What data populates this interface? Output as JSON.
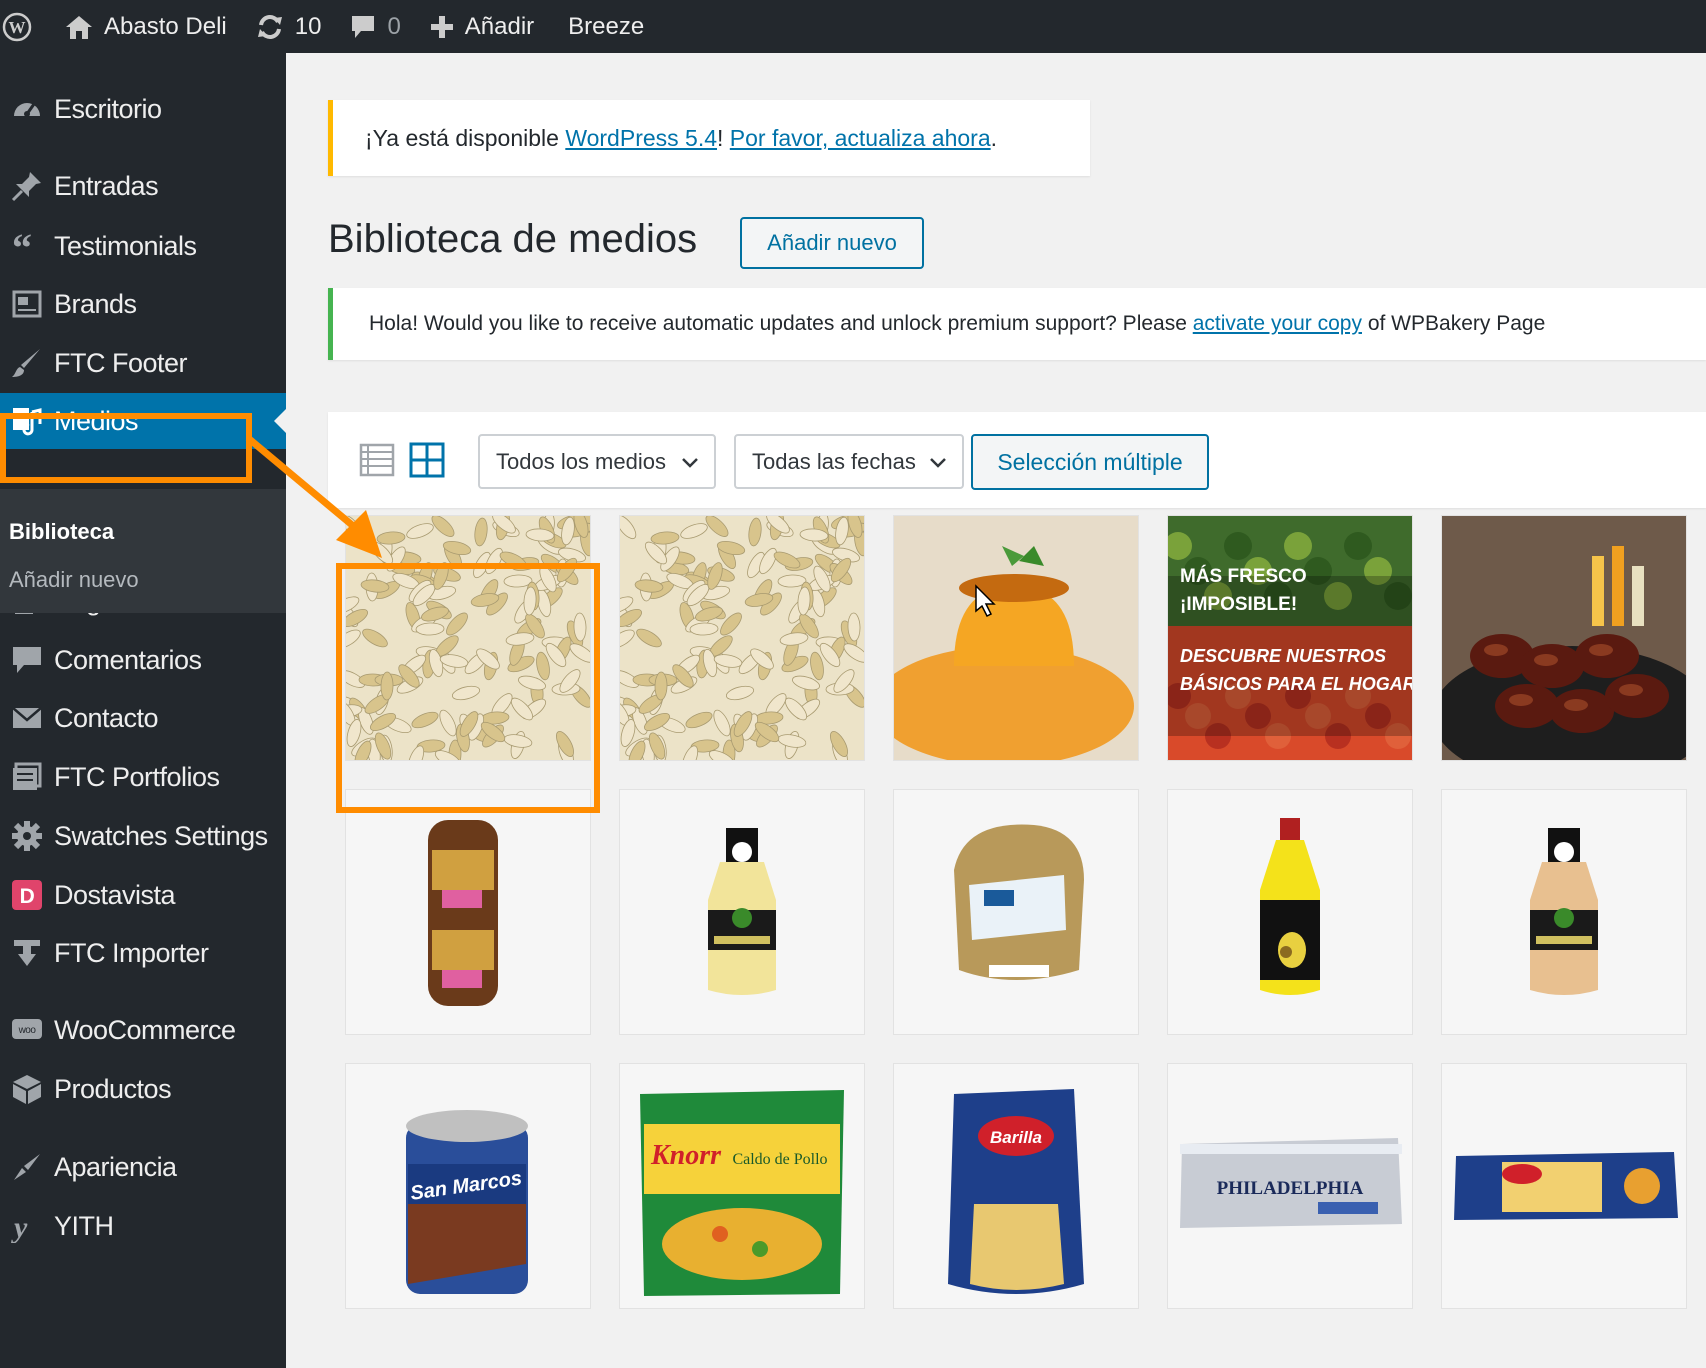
{
  "admin_bar": {
    "site_name": "Abasto Deli",
    "updates_count": "10",
    "comments_count": "0",
    "add_label": "Añadir",
    "plugin_label": "Breeze"
  },
  "sidebar": {
    "items": [
      {
        "label": "Escritorio",
        "icon": "dashboard-icon"
      },
      {
        "label": "Entradas",
        "icon": "pin-icon"
      },
      {
        "label": "Testimonials",
        "icon": "quote-icon"
      },
      {
        "label": "Brands",
        "icon": "brands-icon"
      },
      {
        "label": "FTC Footer",
        "icon": "brush-icon"
      },
      {
        "label": "Medios",
        "icon": "media-icon"
      },
      {
        "label": "Páginas",
        "icon": "pages-icon"
      },
      {
        "label": "Comentarios",
        "icon": "comments-icon"
      },
      {
        "label": "Contacto",
        "icon": "mail-icon"
      },
      {
        "label": "FTC Portfolios",
        "icon": "portfolio-icon"
      },
      {
        "label": "Swatches Settings",
        "icon": "gear-icon"
      },
      {
        "label": "Dostavista",
        "icon": "dostavista-icon"
      },
      {
        "label": "FTC Importer",
        "icon": "download-icon"
      },
      {
        "label": "WooCommerce",
        "icon": "woocommerce-icon"
      },
      {
        "label": "Productos",
        "icon": "box-icon"
      },
      {
        "label": "Apariencia",
        "icon": "appearance-icon"
      },
      {
        "label": "YITH",
        "icon": "yith-icon"
      }
    ],
    "submenu": [
      "Biblioteca",
      "Añadir nuevo"
    ]
  },
  "notices": {
    "update_prefix": "¡Ya está disponible ",
    "update_link1": "WordPress 5.4",
    "update_mid": "! ",
    "update_link2": "Por favor, actualiza ahora",
    "update_suffix": ".",
    "wpb_prefix": "Hola! Would you like to receive automatic updates and unlock premium support? Please ",
    "wpb_link": "activate your copy",
    "wpb_suffix": " of WPBakery Page"
  },
  "page": {
    "title": "Biblioteca de medios",
    "add_new_label": "Añadir nuevo"
  },
  "toolbar": {
    "filter_media": "Todos los medios",
    "filter_dates": "Todas las fechas",
    "bulk_select": "Selección múltiple"
  },
  "media_grid": [
    {
      "name": "pasta-salad-1"
    },
    {
      "name": "pasta-salad-2"
    },
    {
      "name": "flan-dessert"
    },
    {
      "name": "fresh-produce-banner",
      "text": [
        "MÁS FRESCO",
        "¡IMPOSIBLE!",
        "DESCUBRE NUESTROS",
        "BÁSICOS PARA EL HOGAR"
      ]
    },
    {
      "name": "bbq-wings"
    },
    {
      "name": "sausage-pack"
    },
    {
      "name": "dressing-bottle-cilantro"
    },
    {
      "name": "bread-loaf"
    },
    {
      "name": "oil-bottle"
    },
    {
      "name": "dressing-bottle-honey"
    },
    {
      "name": "beans-can",
      "text": [
        "San Marcos"
      ]
    },
    {
      "name": "knorr-broth",
      "text": [
        "Knorr",
        "Caldo de Pollo"
      ]
    },
    {
      "name": "barilla-pasta",
      "text": [
        "Barilla"
      ]
    },
    {
      "name": "philadelphia-cheese",
      "text": [
        "PHILADELPHIA"
      ]
    },
    {
      "name": "spaghetti-pack"
    }
  ],
  "colors": {
    "admin_dark": "#23282d",
    "wp_blue": "#0073aa",
    "highlight_orange": "#ff8c00",
    "update_yellow": "#ffb900",
    "notice_green": "#46b450"
  }
}
